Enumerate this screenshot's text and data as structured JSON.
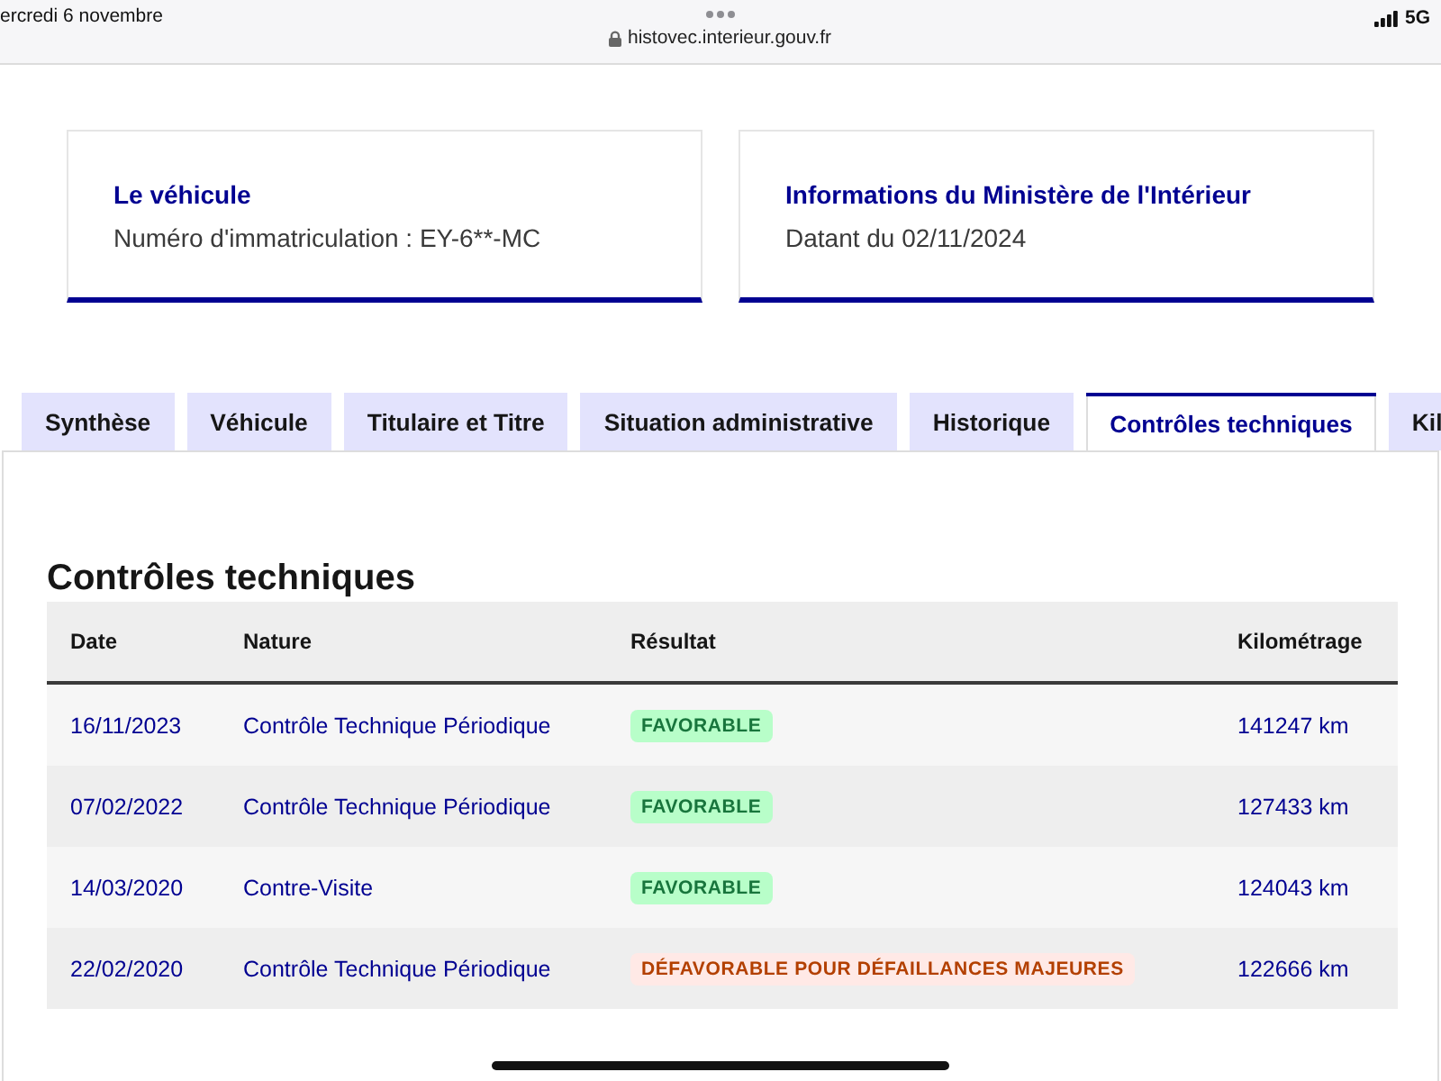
{
  "status_bar": {
    "date": "ercredi 6 novembre",
    "url": "histovec.interieur.gouv.fr",
    "network": "5G"
  },
  "cards": [
    {
      "title": "Le véhicule",
      "text": "Numéro d'immatriculation : EY-6**-MC"
    },
    {
      "title": "Informations du Ministère de l'Intérieur",
      "text": "Datant du 02/11/2024"
    }
  ],
  "tabs": [
    {
      "label": "Synthèse",
      "selected": false
    },
    {
      "label": "Véhicule",
      "selected": false
    },
    {
      "label": "Titulaire et Titre",
      "selected": false
    },
    {
      "label": "Situation administrative",
      "selected": false
    },
    {
      "label": "Historique",
      "selected": false
    },
    {
      "label": "Contrôles techniques",
      "selected": true
    },
    {
      "label": "Kil",
      "selected": false
    }
  ],
  "section": {
    "title": "Contrôles techniques",
    "table": {
      "columns": [
        "Date",
        "Nature",
        "Résultat",
        "Kilométrage"
      ],
      "rows": [
        {
          "date": "16/11/2023",
          "nature": "Contrôle Technique Périodique",
          "result": {
            "label": "FAVORABLE",
            "kind": "success"
          },
          "mileage": "141247 km"
        },
        {
          "date": "07/02/2022",
          "nature": "Contrôle Technique Périodique",
          "result": {
            "label": "FAVORABLE",
            "kind": "success"
          },
          "mileage": "127433 km"
        },
        {
          "date": "14/03/2020",
          "nature": "Contre-Visite",
          "result": {
            "label": "FAVORABLE",
            "kind": "success"
          },
          "mileage": "124043 km"
        },
        {
          "date": "22/02/2020",
          "nature": "Contrôle Technique Périodique",
          "result": {
            "label": "DÉFAVORABLE POUR DÉFAILLANCES MAJEURES",
            "kind": "error"
          },
          "mileage": "122666 km"
        }
      ]
    }
  }
}
